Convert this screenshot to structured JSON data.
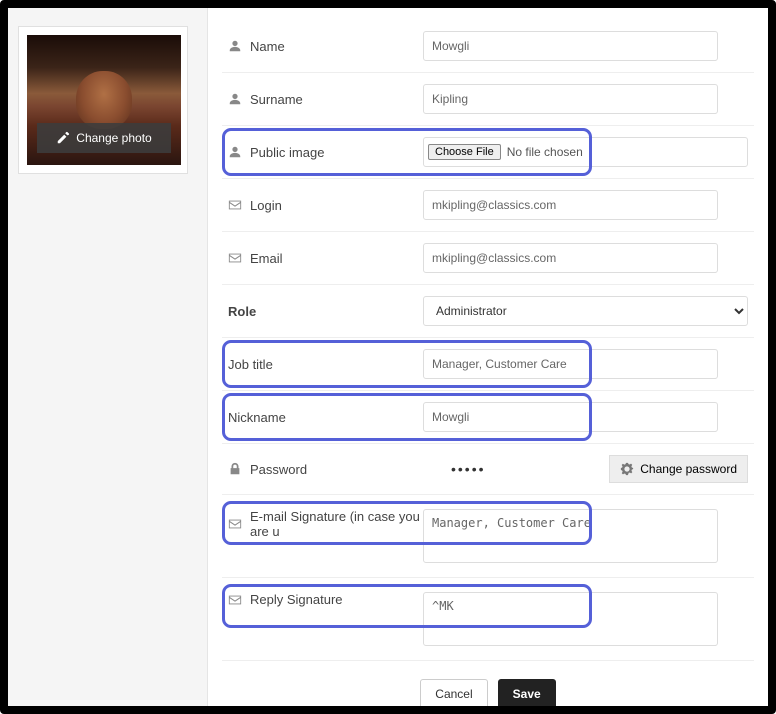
{
  "sidebar": {
    "change_photo_label": "Change photo"
  },
  "fields": {
    "name": {
      "label": "Name",
      "value": "Mowgli"
    },
    "surname": {
      "label": "Surname",
      "value": "Kipling"
    },
    "public_image": {
      "label": "Public image",
      "button": "Choose File",
      "status": "No file chosen"
    },
    "login": {
      "label": "Login",
      "value": "mkipling@classics.com"
    },
    "email": {
      "label": "Email",
      "value": "mkipling@classics.com"
    },
    "role": {
      "label": "Role",
      "value": "Administrator"
    },
    "job_title": {
      "label": "Job title",
      "value": "Manager, Customer Care"
    },
    "nickname": {
      "label": "Nickname",
      "value": "Mowgli"
    },
    "password": {
      "label": "Password",
      "masked": "•••••",
      "change_btn": "Change password"
    },
    "email_sig": {
      "label": "E-mail Signature (in case you are u",
      "value": "Manager, Customer Care"
    },
    "reply_sig": {
      "label": "Reply Signature",
      "value": "^MK"
    }
  },
  "footer": {
    "cancel": "Cancel",
    "save": "Save"
  }
}
